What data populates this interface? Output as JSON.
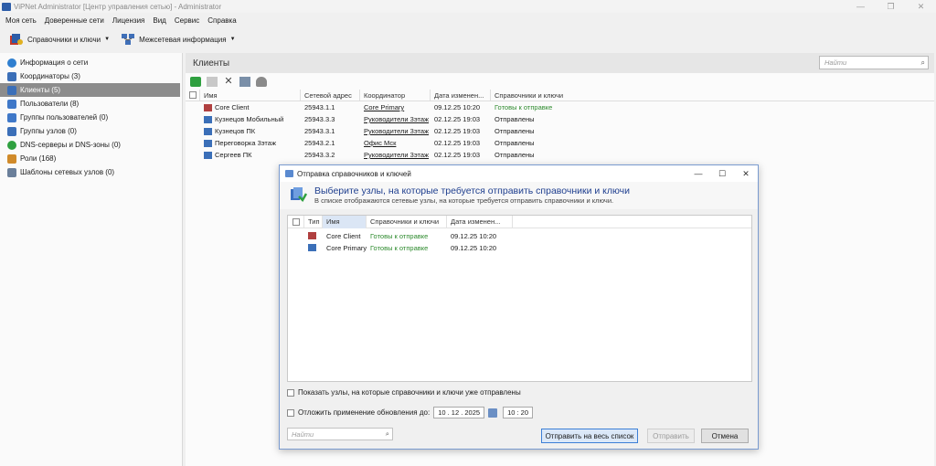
{
  "window": {
    "title": "ViPNet Administrator [Центр управления сетью] - Administrator",
    "controls": [
      "—",
      "❐",
      "✕"
    ]
  },
  "menu": [
    "Моя сеть",
    "Доверенные сети",
    "Лицензия",
    "Вид",
    "Сервис",
    "Справка"
  ],
  "toolbar": {
    "keys_label": "Справочники и ключи",
    "internet_label": "Межсетевая информация"
  },
  "sidebar": {
    "items": [
      {
        "label": "Информация о сети",
        "color": "#2f7fd0"
      },
      {
        "label": "Координаторы (3)",
        "color": "#3b6fb8"
      },
      {
        "label": "Клиенты (5)",
        "color": "#3b6fb8"
      },
      {
        "label": "Пользователи (8)",
        "color": "#3f78c8"
      },
      {
        "label": "Группы пользователей (0)",
        "color": "#3f78c8"
      },
      {
        "label": "Группы узлов (0)",
        "color": "#3b6fb8"
      },
      {
        "label": "DNS-серверы и DNS-зоны (0)",
        "color": "#2fa040"
      },
      {
        "label": "Роли (168)",
        "color": "#d08a2a"
      },
      {
        "label": "Шаблоны сетевых узлов (0)",
        "color": "#6a7f9a"
      }
    ],
    "selected_index": 2
  },
  "main": {
    "title": "Клиенты",
    "search_placeholder": "Найти",
    "columns": [
      "Имя",
      "Сетевой адрес",
      "Координатор",
      "Дата изменен...",
      "Справочники и ключи"
    ],
    "rows": [
      {
        "name": "Core Client",
        "addr": "25943.1.1",
        "coord": "Core Primary",
        "date": "09.12.25 10:20",
        "status": "Готовы к отправке",
        "ready": true
      },
      {
        "name": "Кузнецов Мобильный",
        "addr": "25943.3.3",
        "coord": "Руководители 3этаж",
        "date": "02.12.25 19:03",
        "status": "Отправлены",
        "ready": false
      },
      {
        "name": "Кузнецов ПК",
        "addr": "25943.3.1",
        "coord": "Руководители 3этаж",
        "date": "02.12.25 19:03",
        "status": "Отправлены",
        "ready": false
      },
      {
        "name": "Переговорка 3этаж",
        "addr": "25943.2.1",
        "coord": "Офис Мск",
        "date": "02.12.25 19:03",
        "status": "Отправлены",
        "ready": false
      },
      {
        "name": "Сергеев ПК",
        "addr": "25943.3.2",
        "coord": "Руководители 3этаж",
        "date": "02.12.25 19:03",
        "status": "Отправлены",
        "ready": false
      }
    ]
  },
  "dialog": {
    "title": "Отправка справочников и ключей",
    "heading": "Выберите узлы, на которые требуется отправить справочники и ключи",
    "subheading": "В списке отображаются сетевые узлы, на которые требуется отправить справочники и ключи.",
    "columns": [
      "Тип",
      "Имя",
      "Справочники и ключи",
      "Дата изменен..."
    ],
    "rows": [
      {
        "name": "Core Client",
        "status": "Готовы к отправке",
        "date": "09.12.25 10:20"
      },
      {
        "name": "Core Primary",
        "status": "Готовы к отправке",
        "date": "09.12.25 10:20"
      }
    ],
    "show_sent_label": "Показать узлы, на которые справочники и ключи уже отправлены",
    "defer_label": "Отложить применение обновления до:",
    "defer_date": "10 . 12 . 2025",
    "defer_time": "10 : 20",
    "search_placeholder": "Найти",
    "buttons": {
      "send_all": "Отправить на весь список",
      "send": "Отправить",
      "cancel": "Отмена"
    }
  }
}
